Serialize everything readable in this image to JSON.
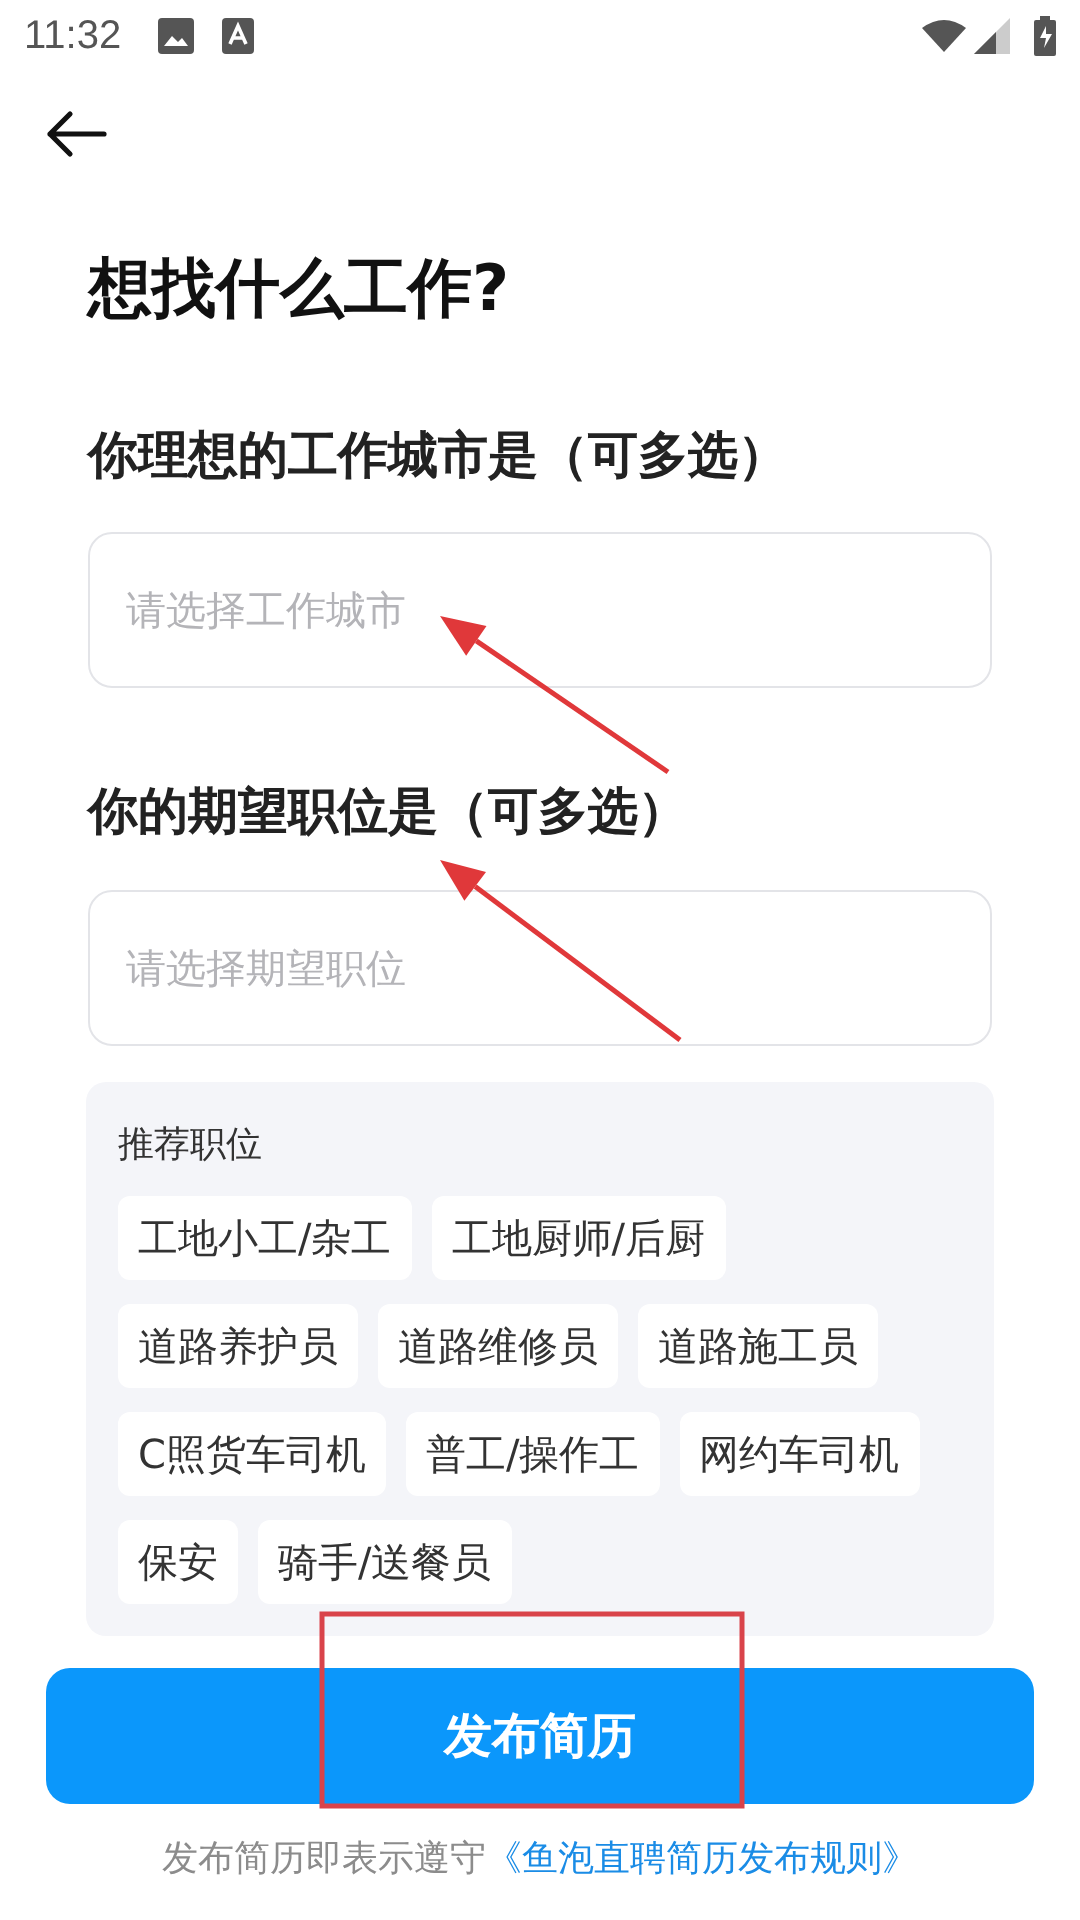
{
  "status_bar": {
    "time": "11:32"
  },
  "title": "想找什么工作?",
  "sections": [
    {
      "heading": "你理想的工作城市是（可多选）",
      "placeholder": "请选择工作城市"
    },
    {
      "heading": "你的期望职位是（可多选）",
      "placeholder": "请选择期望职位"
    }
  ],
  "recommended": {
    "label": "推荐职位",
    "tags": [
      "工地小工/杂工",
      "工地厨师/后厨",
      "道路养护员",
      "道路维修员",
      "道路施工员",
      "C照货车司机",
      "普工/操作工",
      "网约车司机",
      "保安",
      "骑手/送餐员"
    ]
  },
  "submit_button": "发布简历",
  "footer": {
    "text": "发布简历即表示遵守",
    "link": "《鱼泡直聘简历发布规则》"
  },
  "annotations": [
    {
      "kind": "arrow"
    },
    {
      "kind": "arrow"
    },
    {
      "kind": "box"
    }
  ]
}
